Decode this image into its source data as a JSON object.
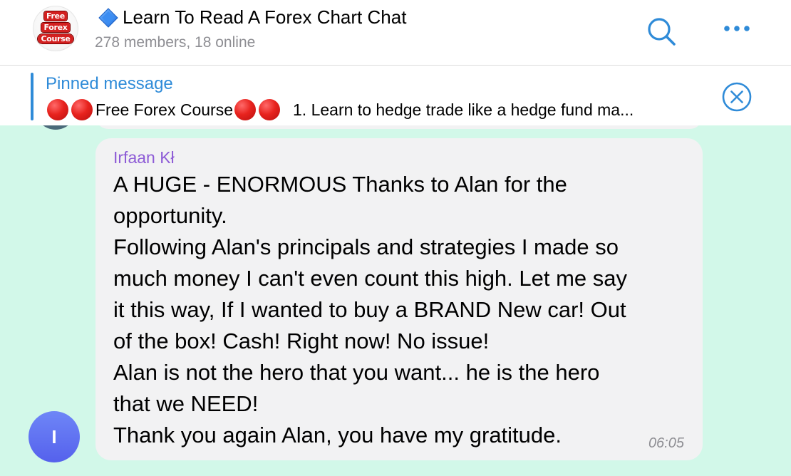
{
  "header": {
    "logo_lines": [
      "Free",
      "Forex",
      "Course"
    ],
    "title": "Learn To Read A Forex Chart Chat",
    "subtitle": "278 members, 18 online",
    "title_icon": "blue-diamond-icon",
    "search_icon": "search-icon",
    "more_icon": "ellipsis-icon"
  },
  "pinned": {
    "label": "Pinned message",
    "text_part1": "Free Forex Course",
    "text_part2": "1. Learn to hedge trade like a hedge fund ma...",
    "close_icon": "close-circle-icon"
  },
  "message": {
    "sender": "Irfaan Kł",
    "text": "A HUGE - ENORMOUS Thanks to Alan for the\nopportunity.\nFollowing Alan's principals and strategies I made so\nmuch money I can't even count this high. Let me say\nit this way, If I wanted to buy a BRAND New car! Out\nof the box! Cash! Right now! No issue!\nAlan is not the hero that you want... he is the hero\nthat we NEED!\nThank you again Alan, you have my gratitude.",
    "time": "06:05",
    "avatar_initial": "I"
  },
  "colors": {
    "accent": "#2f8bd8",
    "chat_background": "#d2f8e9",
    "bubble": "#f2f2f3",
    "sender_name": "#8d5bd6",
    "avatar": "#5f70f2",
    "red_dot": "#e8231e"
  }
}
